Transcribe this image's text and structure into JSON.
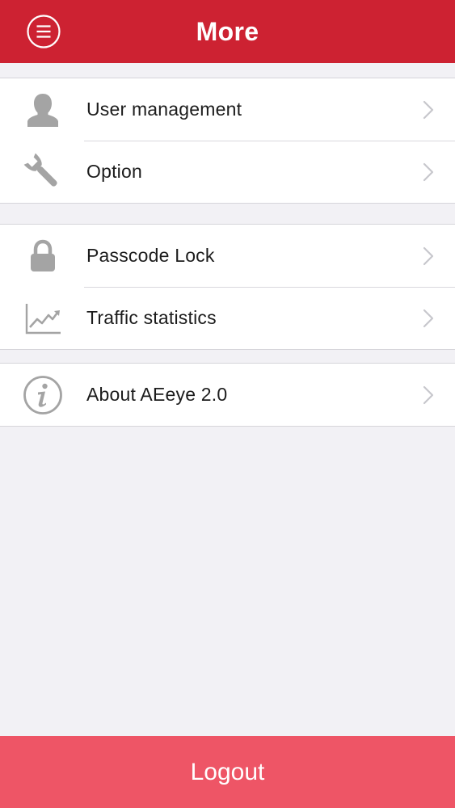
{
  "header": {
    "title": "More",
    "menu_icon": "hamburger-circle-icon"
  },
  "groups": [
    {
      "items": [
        {
          "label": "User management",
          "icon": "user-silhouette-icon"
        },
        {
          "label": "Option",
          "icon": "wrench-icon"
        }
      ]
    },
    {
      "items": [
        {
          "label": "Passcode Lock",
          "icon": "padlock-icon"
        },
        {
          "label": "Traffic statistics",
          "icon": "line-chart-icon"
        }
      ]
    },
    {
      "items": [
        {
          "label": "About AEeye 2.0",
          "icon": "info-circle-icon"
        }
      ]
    }
  ],
  "footer": {
    "logout_label": "Logout"
  },
  "colors": {
    "header_bg": "#cd2232",
    "logout_bg": "#ee5566",
    "page_bg": "#f2f1f5",
    "icon_gray": "#a4a4a4",
    "chevron_gray": "#c7c7cc"
  }
}
